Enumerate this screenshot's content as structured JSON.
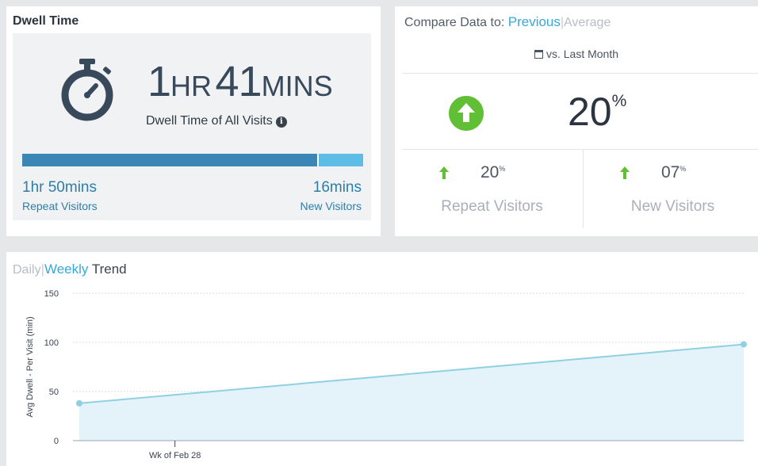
{
  "dwell": {
    "title": "Dwell Time",
    "hours_num": "1",
    "hours_unit": "HR",
    "mins_num": "41",
    "mins_unit": "MINS",
    "subtitle": "Dwell Time of All Visits",
    "info_icon": "i",
    "repeat_share": 0.87,
    "repeat_value": "1hr 50mins",
    "repeat_label": "Repeat Visitors",
    "new_value": "16mins",
    "new_label": "New Visitors",
    "colors": {
      "repeat": "#3a86b4",
      "new": "#5dbde6",
      "icon": "#37495b"
    }
  },
  "compare": {
    "prefix": "Compare Data to:",
    "option_active": "Previous",
    "separator": "|",
    "option_inactive": "Average",
    "calendar_icon": "calendar-icon",
    "vs_label": "vs. Last Month",
    "total_pct": "20",
    "pct_sign": "%",
    "repeat_pct": "20",
    "repeat_label": "Repeat Visitors",
    "new_pct": "07",
    "new_label": "New Visitors",
    "colors": {
      "up": "#61bf35",
      "active": "#35a9d9"
    }
  },
  "trend": {
    "option_inactive": "Daily",
    "separator": "|",
    "option_active": "Weekly",
    "suffix": "Trend"
  },
  "chart_data": {
    "type": "area",
    "ylabel": "Avg Dwell - Per Visit (min)",
    "xlabel": "",
    "ylim": [
      0,
      150
    ],
    "yticks": [
      0,
      50,
      100,
      150
    ],
    "x_ticks": [
      {
        "label": "Wk of Feb 28",
        "at": 0.144
      }
    ],
    "series": [
      {
        "points": [
          {
            "x": 0,
            "y": 38
          },
          {
            "x": 1,
            "y": 98
          }
        ]
      }
    ],
    "grid": true,
    "colors": {
      "line": "#8fd0e2",
      "fill": "#e3f3f9",
      "point": "#8fd0e2"
    }
  }
}
